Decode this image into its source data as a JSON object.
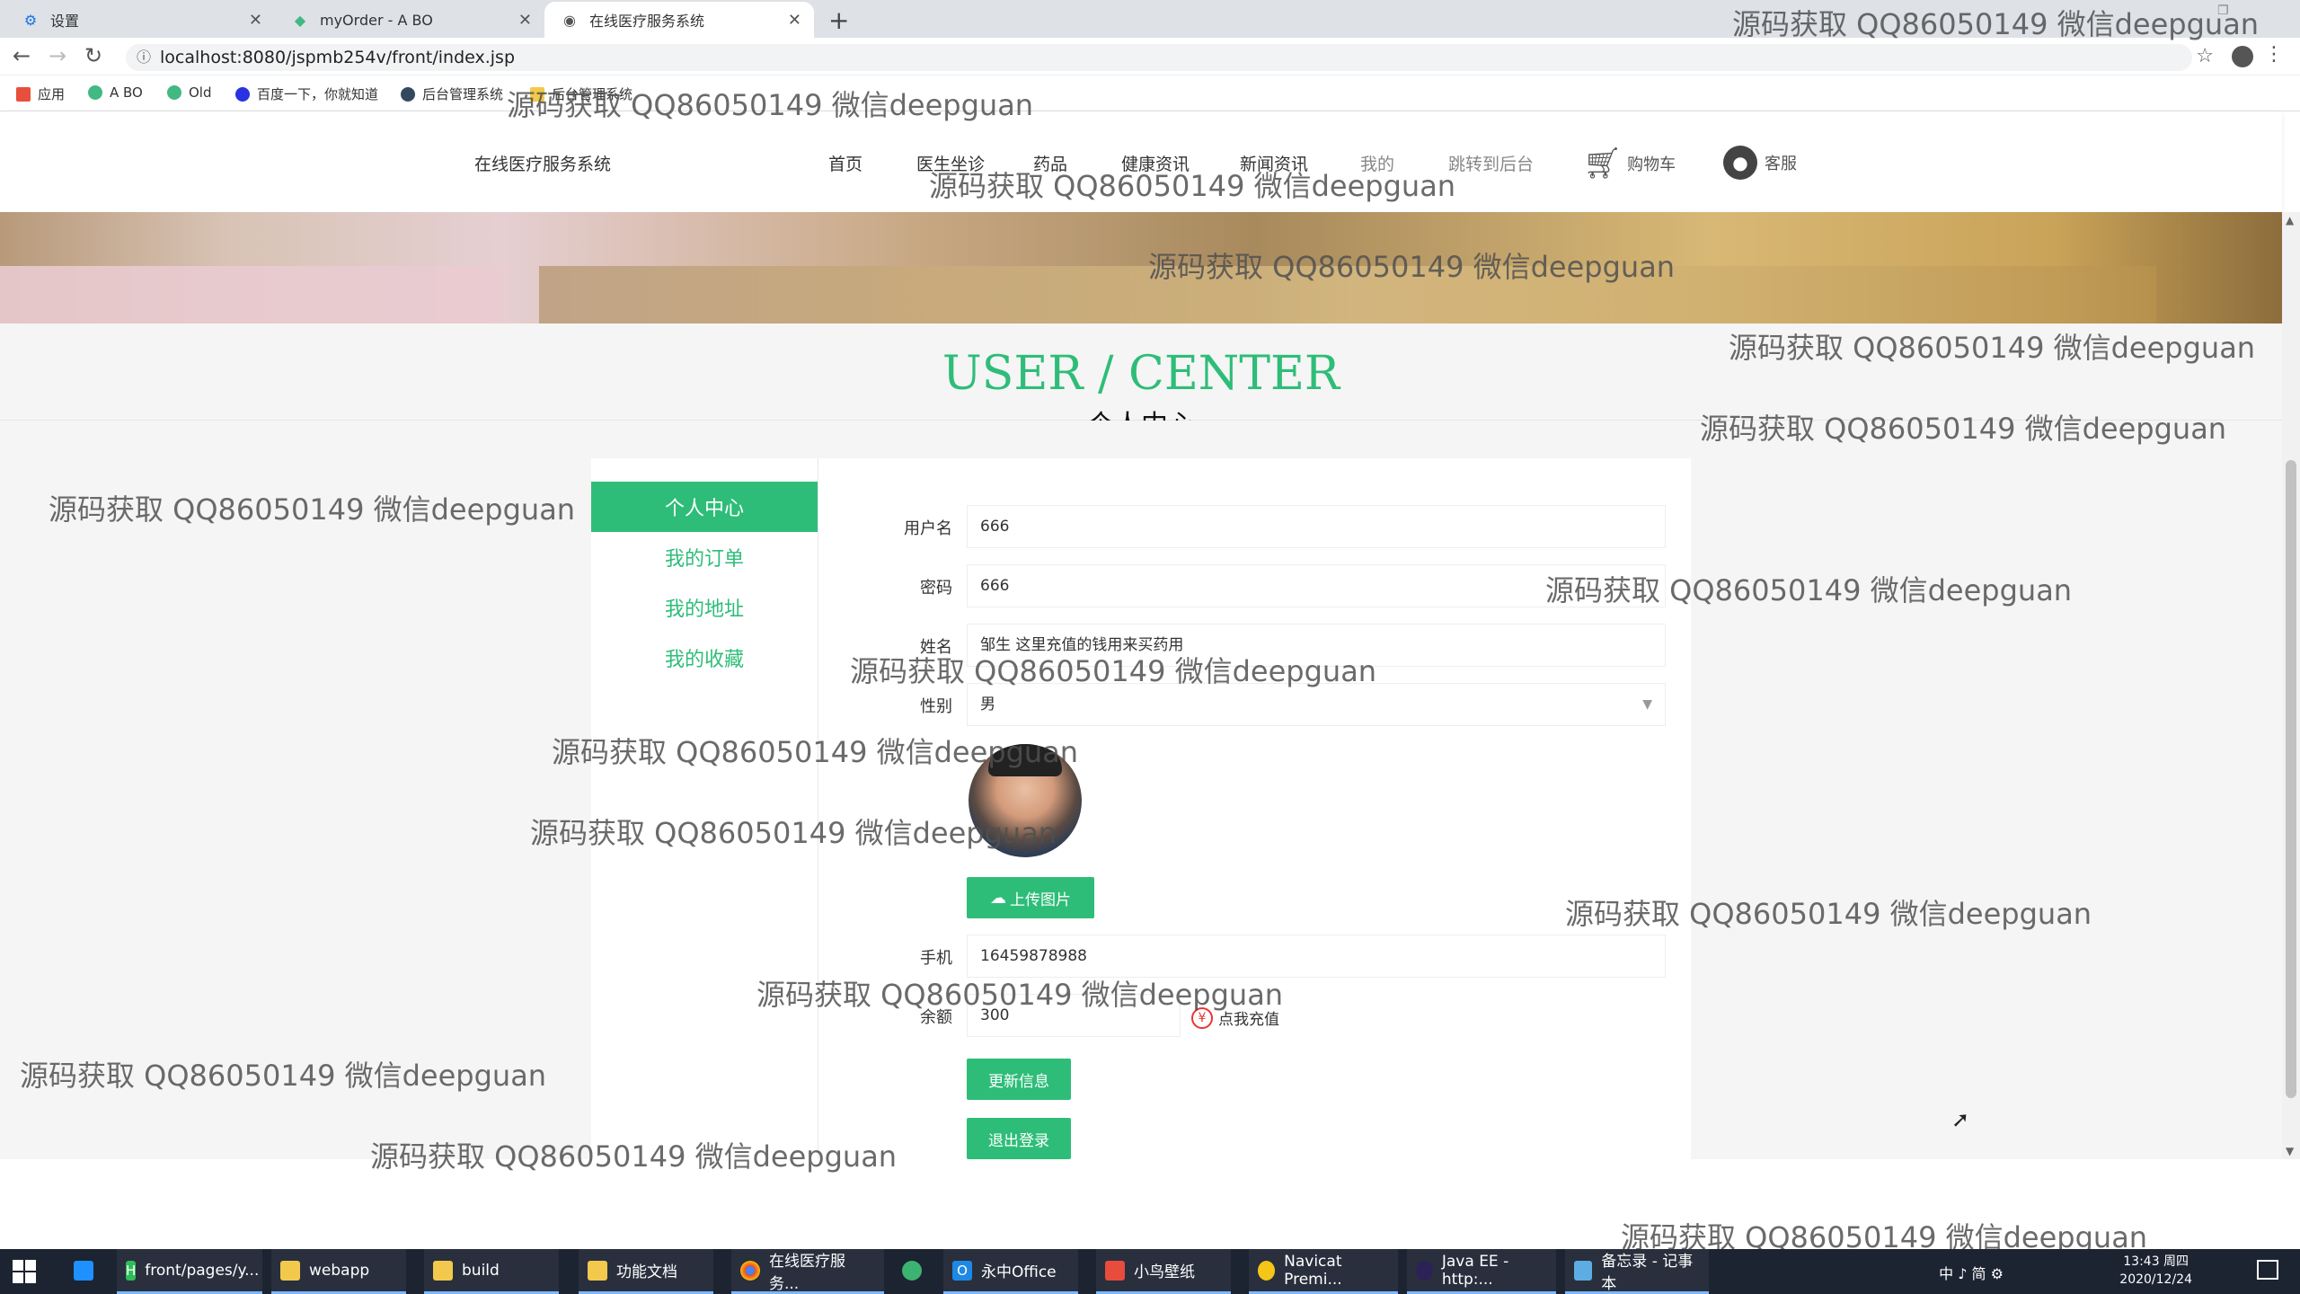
{
  "browser": {
    "tabs": [
      {
        "label": "设置",
        "icon": "gear-icon"
      },
      {
        "label": "myOrder - A BO",
        "icon": "vue-icon"
      },
      {
        "label": "在线医疗服务系统",
        "icon": "globe-icon"
      }
    ],
    "url": "localhost:8080/jspmb254v/front/index.jsp",
    "bookmarks": [
      {
        "label": "应用"
      },
      {
        "label": "A BO"
      },
      {
        "label": "Old"
      },
      {
        "label": "百度一下，你就知道"
      },
      {
        "label": "后台管理系统"
      },
      {
        "label": "后台管理系统"
      }
    ]
  },
  "site": {
    "brand": "在线医疗服务系统",
    "nav": [
      "首页",
      "医生坐诊",
      "药品",
      "健康资讯",
      "新闻资讯",
      "我的",
      "跳转到后台"
    ],
    "cart_label": "购物车",
    "kefu_label": "客服"
  },
  "page": {
    "title_en": "USER / CENTER",
    "title_cn": "个人中心"
  },
  "sidebar": {
    "items": [
      {
        "label": "个人中心",
        "active": true
      },
      {
        "label": "我的订单"
      },
      {
        "label": "我的地址"
      },
      {
        "label": "我的收藏"
      }
    ]
  },
  "form": {
    "username_label": "用户名",
    "username": "666",
    "password_label": "密码",
    "password": "666",
    "name_label": "姓名",
    "name": "邹生 这里充值的钱用来买药用",
    "gender_label": "性别",
    "gender": "男",
    "upload_label": "上传图片",
    "phone_label": "手机",
    "phone": "16459878988",
    "balance_label": "余额",
    "balance": "300",
    "recharge_label": "点我充值",
    "update_label": "更新信息",
    "logout_label": "退出登录"
  },
  "watermark_text": "源码获取 QQ86050149 微信deepguan",
  "taskbar": {
    "items": [
      {
        "label": "front/pages/y..."
      },
      {
        "label": "webapp"
      },
      {
        "label": "build"
      },
      {
        "label": "功能文档"
      },
      {
        "label": "在线医疗服务..."
      },
      {
        "label": ""
      },
      {
        "label": "永中Office"
      },
      {
        "label": "小鸟壁纸"
      },
      {
        "label": "Navicat Premi..."
      },
      {
        "label": "Java EE - http:..."
      },
      {
        "label": "备忘录 - 记事本"
      }
    ],
    "tray": "中 ♪ 简 ⚙",
    "time": "13:43 周四",
    "date": "2020/12/24"
  },
  "colors": {
    "accent": "#2ebd79",
    "taskbar": "#1c2331"
  }
}
